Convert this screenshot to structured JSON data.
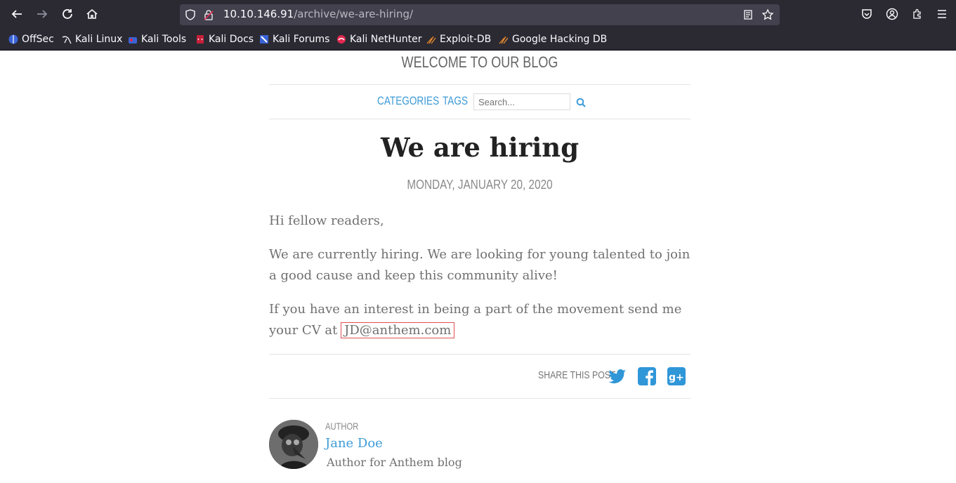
{
  "browser": {
    "url_host": "10.10.146.91",
    "url_path": "/archive/we-are-hiring/",
    "bookmarks": [
      {
        "label": "OffSec",
        "icon": "offsec-icon"
      },
      {
        "label": "Kali Linux",
        "icon": "kali-dragon-icon"
      },
      {
        "label": "Kali Tools",
        "icon": "kali-tools-icon"
      },
      {
        "label": "Kali Docs",
        "icon": "kali-docs-icon"
      },
      {
        "label": "Kali Forums",
        "icon": "kali-forums-icon"
      },
      {
        "label": "Kali NetHunter",
        "icon": "nethunter-icon"
      },
      {
        "label": "Exploit-DB",
        "icon": "exploitdb-icon"
      },
      {
        "label": "Google Hacking DB",
        "icon": "ghdb-icon"
      }
    ]
  },
  "blog": {
    "title": "WELCOME TO OUR BLOG",
    "menu": {
      "categories": "CATEGORIES",
      "tags": "TAGS"
    },
    "search_placeholder": "Search..."
  },
  "post": {
    "title": "We are hiring",
    "date": "MONDAY, JANUARY 20, 2020",
    "p1": "Hi fellow readers,",
    "p2": "We are currently hiring. We are looking for young talented to join a good cause and keep this community alive!",
    "p3_prefix": "If you have an interest in being a part of the movement send me your CV at ",
    "email": "JD@anthem.com"
  },
  "share": {
    "label": "SHARE THIS POST"
  },
  "author": {
    "label": "AUTHOR",
    "name": "Jane Doe",
    "bio": "Author for Anthem blog"
  },
  "colors": {
    "accent": "#3d9bd6",
    "chrome": "#2b2a33",
    "highlight": "#e05050"
  }
}
